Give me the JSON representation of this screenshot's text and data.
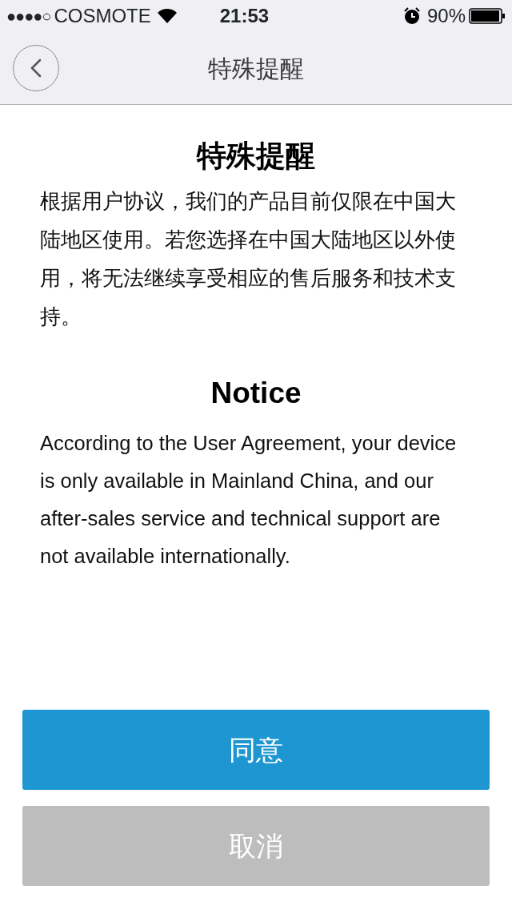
{
  "status_bar": {
    "signal": "●●●●○",
    "carrier": "COSMOTE",
    "time": "21:53",
    "battery_text": "90%"
  },
  "nav": {
    "title": "特殊提醒"
  },
  "sections": [
    {
      "heading": "特殊提醒",
      "body": "根据用户协议，我们的产品目前仅限在中国大陆地区使用。若您选择在中国大陆地区以外使用，将无法继续享受相应的售后服务和技术支持。",
      "kind": "chinese"
    },
    {
      "heading": "Notice",
      "body": "According to the User Agreement, your device is only available in Mainland China, and our after-sales service and technical support are not available internationally.",
      "kind": "english"
    }
  ],
  "buttons": [
    {
      "label": "同意",
      "kind": "primary"
    },
    {
      "label": "取消",
      "kind": "secondary"
    }
  ]
}
